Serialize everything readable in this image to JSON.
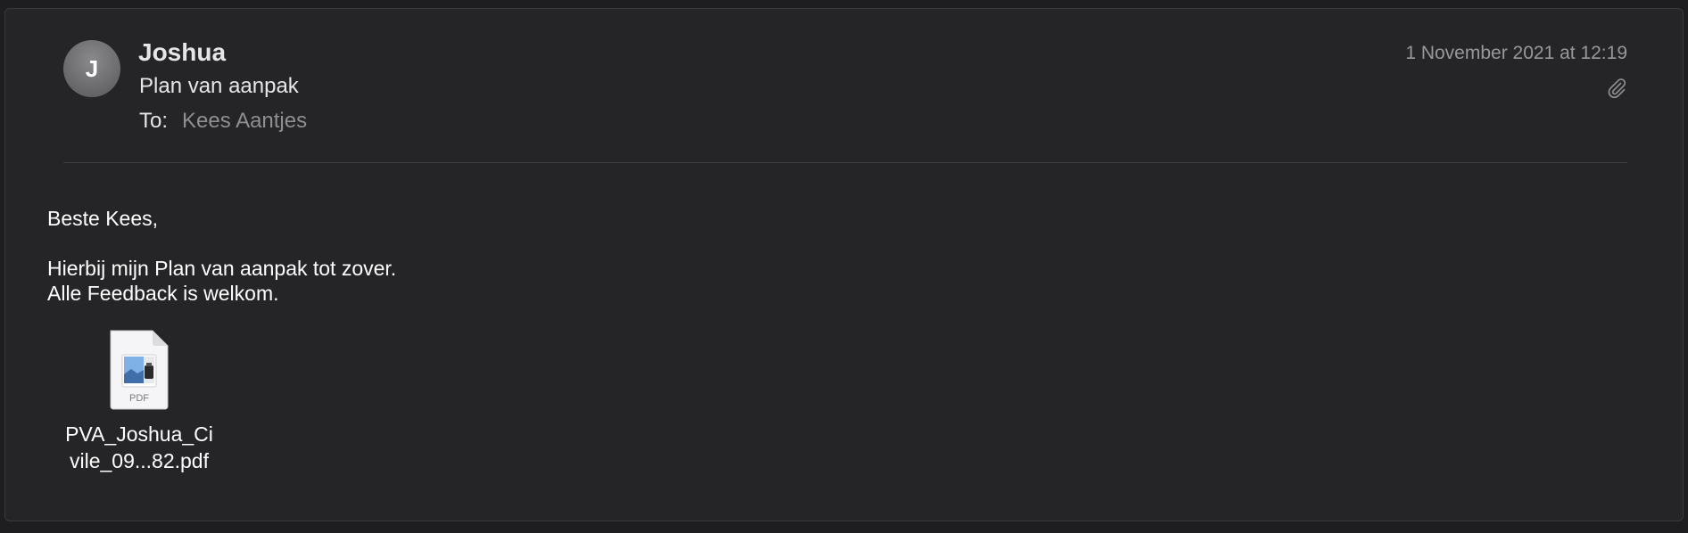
{
  "message": {
    "avatar_initial": "J",
    "sender": "Joshua",
    "subject": "Plan van aanpak",
    "to_label": "To:",
    "to_value": "Kees Aantjes",
    "date": "1 November 2021 at 12:19",
    "attachment_indicator_icon": "paperclip-icon"
  },
  "body": {
    "greeting": "Beste Kees,",
    "line1": "Hierbij mijn Plan van aanpak tot zover.",
    "line2": "Alle Feedback is welkom."
  },
  "attachment": {
    "icon": "pdf-file-icon",
    "type_label": "PDF",
    "name_line1": "PVA_Joshua_Ci",
    "name_line2": "vile_09...82.pdf"
  },
  "colors": {
    "background": "#1e1e20",
    "card": "#252527",
    "primary_text": "#e6e6e8",
    "secondary_text": "#8e8e93"
  }
}
